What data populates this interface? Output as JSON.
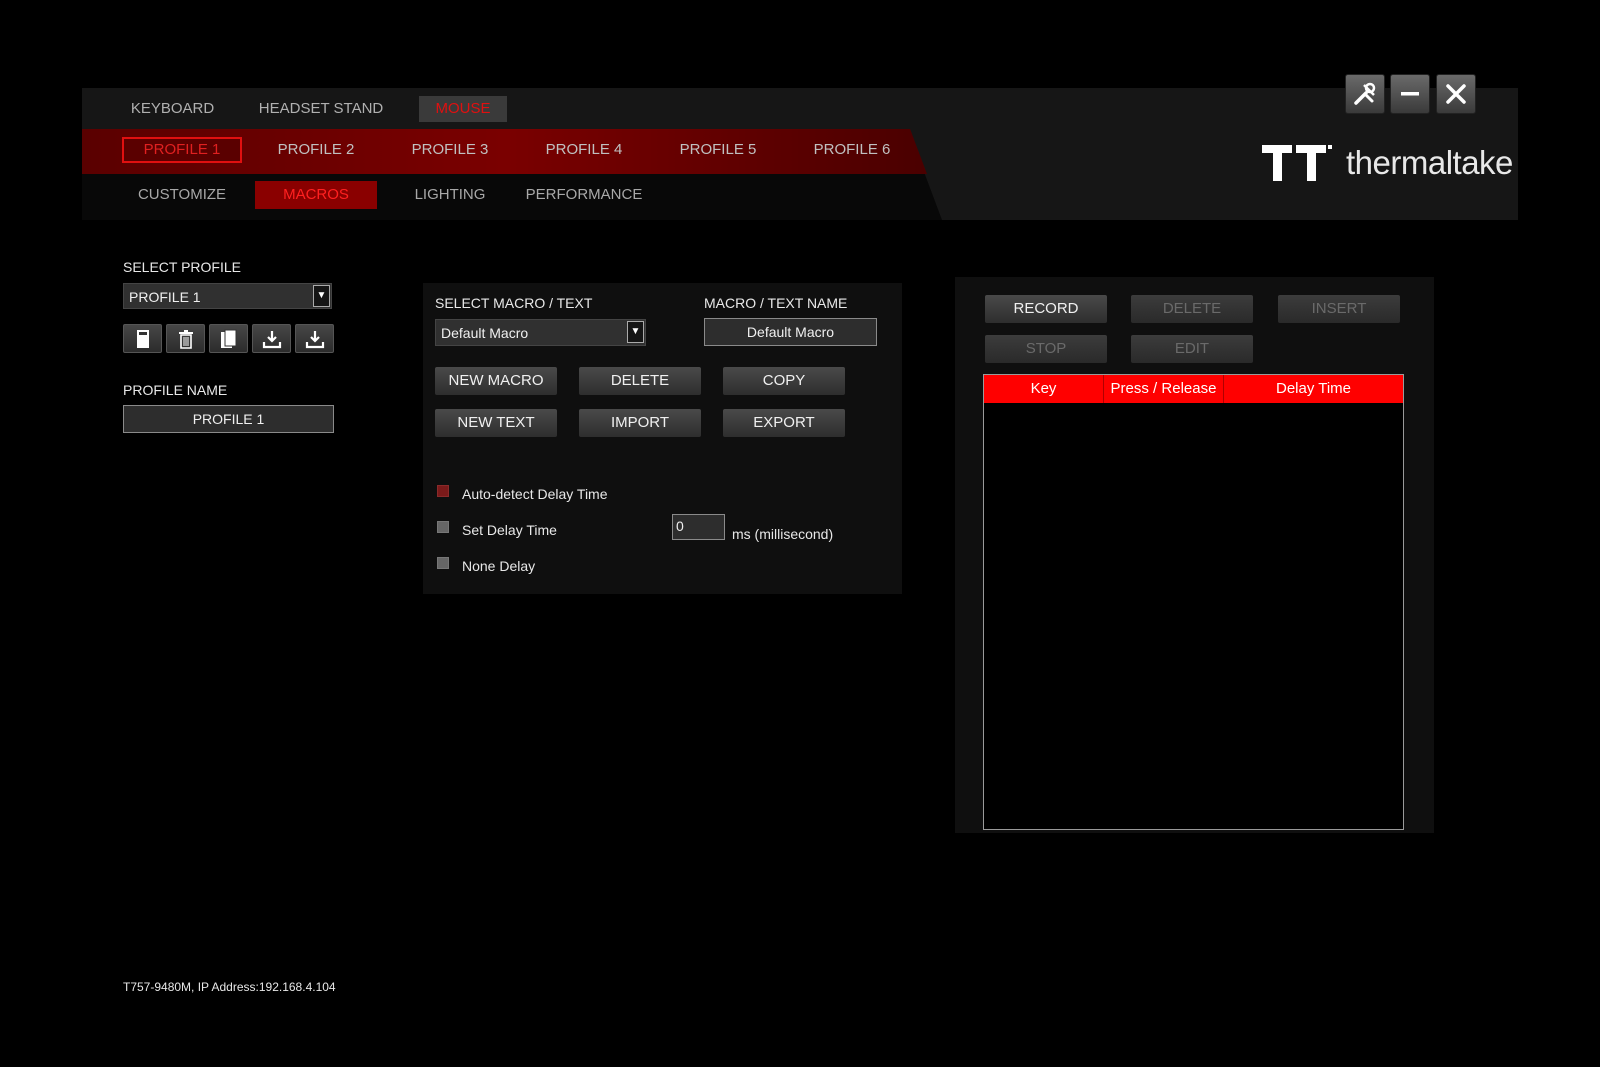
{
  "device_tabs": [
    {
      "label": "KEYBOARD"
    },
    {
      "label": "HEADSET STAND"
    },
    {
      "label": "MOUSE",
      "active": true
    }
  ],
  "profile_tabs": [
    {
      "label": "PROFILE 1",
      "active": true
    },
    {
      "label": "PROFILE 2"
    },
    {
      "label": "PROFILE 3"
    },
    {
      "label": "PROFILE 4"
    },
    {
      "label": "PROFILE 5"
    },
    {
      "label": "PROFILE 6"
    }
  ],
  "sub_tabs": [
    {
      "label": "CUSTOMIZE"
    },
    {
      "label": "MACROS",
      "active": true
    },
    {
      "label": "LIGHTING"
    },
    {
      "label": "PERFORMANCE"
    }
  ],
  "window_controls": {
    "settings": "tools-icon",
    "minimize": "minimize-icon",
    "close": "close-icon"
  },
  "brand": {
    "name": "thermaltake"
  },
  "profile_section": {
    "select_label": "SELECT PROFILE",
    "selected_profile": "PROFILE 1",
    "name_label": "PROFILE NAME",
    "name_value": "PROFILE 1",
    "icons": [
      "save-icon",
      "trash-icon",
      "copy-icon",
      "import-icon",
      "export-icon"
    ]
  },
  "macro_section": {
    "select_label": "SELECT MACRO / TEXT",
    "selected_macro": "Default Macro",
    "name_label": "MACRO / TEXT NAME",
    "name_value": "Default Macro",
    "buttons": {
      "new_macro": "NEW MACRO",
      "delete": "DELETE",
      "copy": "COPY",
      "new_text": "NEW TEXT",
      "import": "IMPORT",
      "export": "EXPORT"
    },
    "options": {
      "auto_detect": "Auto-detect Delay Time",
      "set_delay": "Set Delay Time",
      "none_delay": "None Delay",
      "delay_value": "0",
      "delay_unit": "ms (millisecond)"
    }
  },
  "record_section": {
    "buttons": {
      "record": "RECORD",
      "delete": "DELETE",
      "insert": "INSERT",
      "stop": "STOP",
      "edit": "EDIT"
    },
    "table_headers": [
      "Key",
      "Press / Release",
      "Delay Time"
    ]
  },
  "status_text": "T757-9480M, IP Address:192.168.4.104",
  "colors": {
    "accent": "#ff0000",
    "dark_red": "#7a0000",
    "background": "#000000"
  }
}
